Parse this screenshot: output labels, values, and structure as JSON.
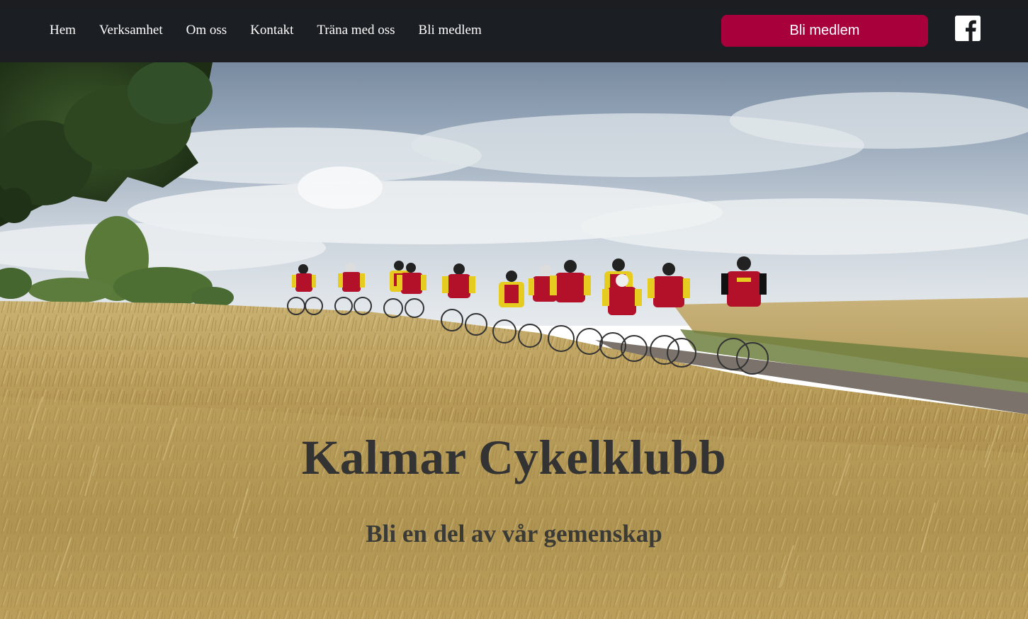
{
  "nav": {
    "items": [
      {
        "label": "Hem"
      },
      {
        "label": "Verksamhet"
      },
      {
        "label": "Om oss"
      },
      {
        "label": "Kontakt"
      },
      {
        "label": "Träna med oss"
      },
      {
        "label": "Bli medlem"
      }
    ],
    "cta_label": "Bli medlem",
    "social_icon": "facebook-icon"
  },
  "hero": {
    "title": "Kalmar Cykelklubb",
    "subtitle": "Bli en del av vår gemenskap",
    "image_icon": "cyclists-wheat-field-photo"
  },
  "colors": {
    "header_bg": "#181a1d",
    "cta_bg": "#a8003a",
    "title_text": "#333333",
    "sky": "#a9b7c6",
    "wheat": "#b99c55",
    "jersey_red": "#b3112a",
    "jersey_yellow": "#e6cc1f"
  }
}
